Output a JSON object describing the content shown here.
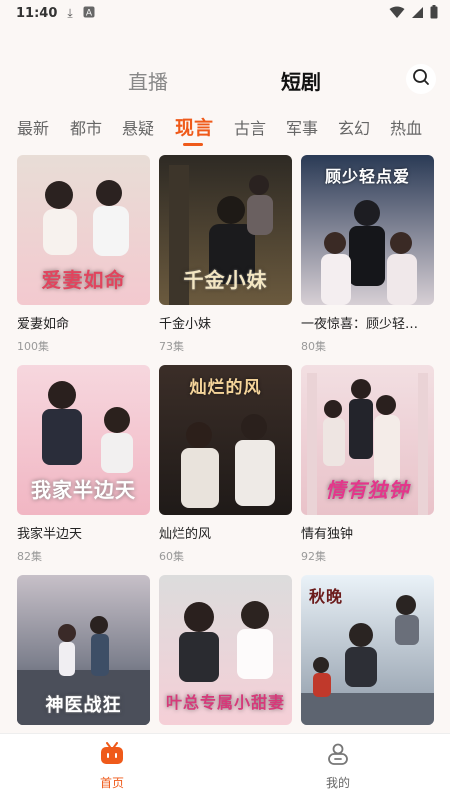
{
  "status": {
    "time": "11:40"
  },
  "top_tabs": {
    "live": "直播",
    "drama": "短剧"
  },
  "categories": [
    "最新",
    "都市",
    "悬疑",
    "现言",
    "古言",
    "军事",
    "玄幻",
    "热血"
  ],
  "active_category": "现言",
  "dramas": [
    {
      "title": "爱妻如命",
      "episodes": "100集",
      "cover_text": "爱妻如命"
    },
    {
      "title": "千金小妹",
      "episodes": "73集",
      "cover_text": "千金小妹"
    },
    {
      "title": "一夜惊喜：顾少轻…",
      "episodes": "80集",
      "cover_text": "顾少轻点爱"
    },
    {
      "title": "我家半边天",
      "episodes": "82集",
      "cover_text": "我家半边天"
    },
    {
      "title": "灿烂的风",
      "episodes": "60集",
      "cover_text": "灿烂的风"
    },
    {
      "title": "情有独钟",
      "episodes": "92集",
      "cover_text": "情有独钟"
    },
    {
      "cover_text": "神医战狂"
    },
    {
      "cover_text": "叶总专属小甜妻"
    },
    {
      "cover_text": "秋晚"
    }
  ],
  "bottom_nav": {
    "home": "首页",
    "mine": "我的"
  },
  "colors": {
    "accent": "#ef5a1a",
    "background": "#fbf7f5"
  }
}
